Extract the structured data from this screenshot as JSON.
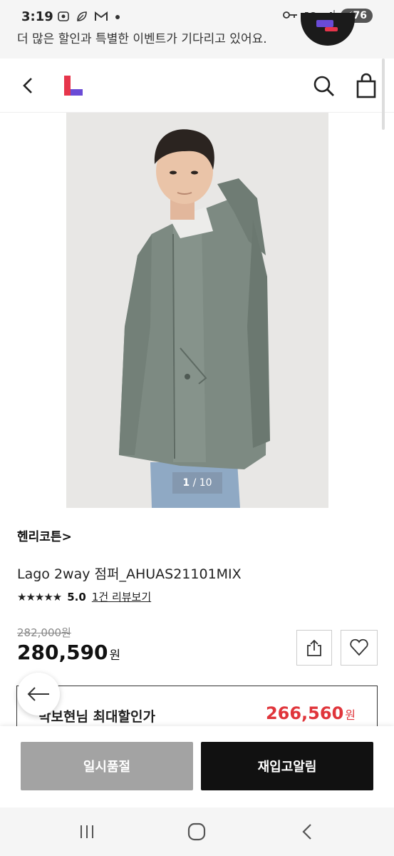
{
  "status_bar": {
    "time": "3:19",
    "left_icons": [
      "record-icon",
      "leaf-icon",
      "gmail-icon",
      "dot-icon"
    ],
    "network": "5G",
    "battery": "76"
  },
  "promo": {
    "text": "더 많은 할인과 특별한 이벤트가 기다리고 있어요."
  },
  "header": {
    "logo_colors": {
      "red": "#e6354b",
      "purple": "#6a4bd6"
    }
  },
  "product": {
    "image_indicator": {
      "current": "1",
      "separator": " / ",
      "total": "10"
    },
    "brand": "헨리코튼",
    "brand_chevron": ">",
    "name": "Lago 2way 점퍼_AHUAS21101MIX",
    "stars": "★★★★★",
    "rating": "5.0",
    "review_link": "1건 리뷰보기",
    "original_price": "282,000원",
    "price": "280,590",
    "price_unit": "원"
  },
  "discount": {
    "label": "박보현님 최대할인가",
    "price": "266,560",
    "price_unit": "원",
    "accent": "#e0353b"
  },
  "actions": {
    "soldout_label": "일시품절",
    "restock_label": "재입고알림"
  }
}
